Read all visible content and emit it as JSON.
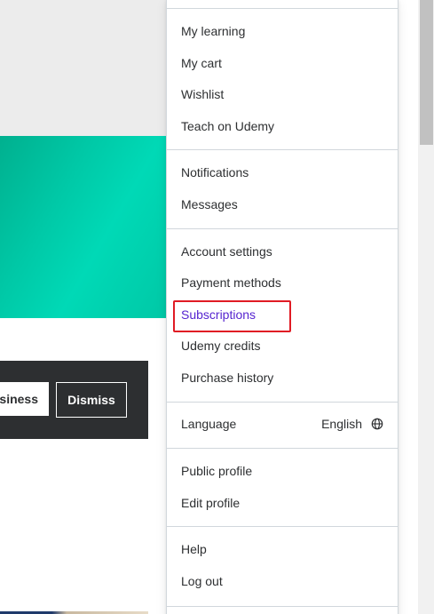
{
  "background": {
    "banner": {
      "business_label": "Business",
      "dismiss_label": "Dismiss"
    }
  },
  "menu": {
    "group1": [
      {
        "label": "My learning"
      },
      {
        "label": "My cart"
      },
      {
        "label": "Wishlist"
      },
      {
        "label": "Teach on Udemy"
      }
    ],
    "group2": [
      {
        "label": "Notifications"
      },
      {
        "label": "Messages"
      }
    ],
    "group3": [
      {
        "label": "Account settings"
      },
      {
        "label": "Payment methods"
      },
      {
        "label": "Subscriptions",
        "highlighted": true
      },
      {
        "label": "Udemy credits"
      },
      {
        "label": "Purchase history"
      }
    ],
    "language": {
      "label": "Language",
      "value": "English",
      "icon": "globe-icon"
    },
    "group4": [
      {
        "label": "Public profile"
      },
      {
        "label": "Edit profile"
      }
    ],
    "group5": [
      {
        "label": "Help"
      },
      {
        "label": "Log out"
      }
    ]
  },
  "colors": {
    "text": "#2d2f31",
    "accent": "#5624d0",
    "highlight_border": "#e01b24",
    "hero": "#00d1b0",
    "banner": "#2d2f31"
  }
}
